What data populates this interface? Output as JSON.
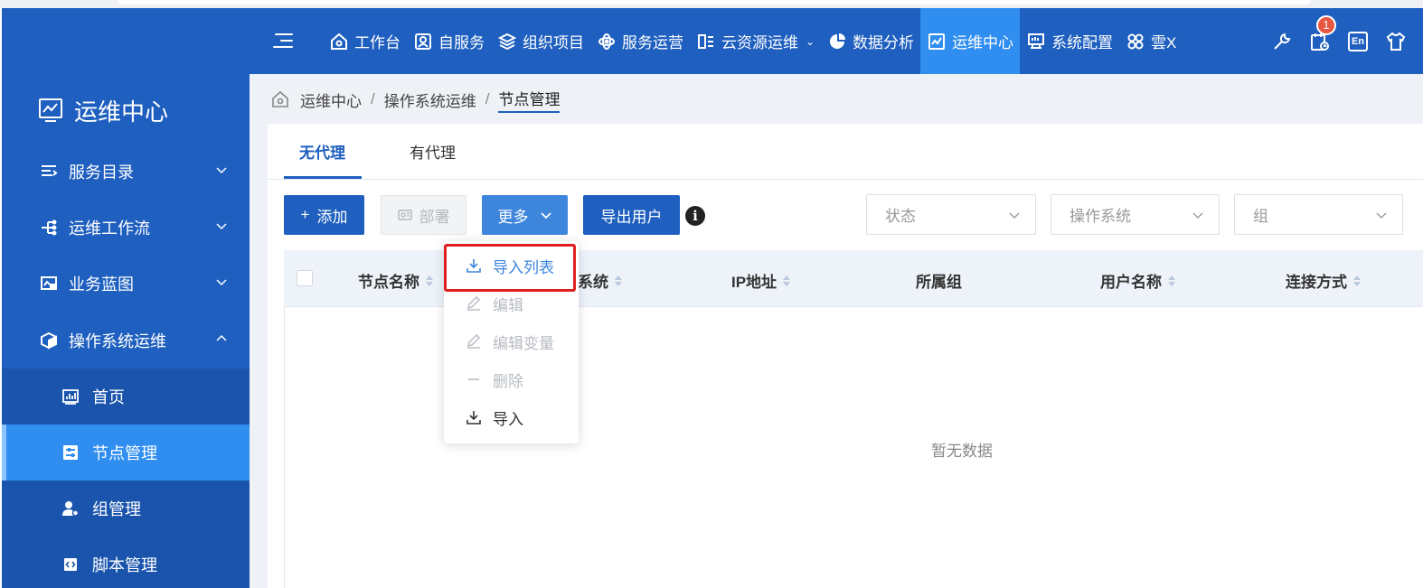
{
  "topnav": {
    "items": [
      {
        "label": "工作台",
        "icon": "home-icon"
      },
      {
        "label": "自服务",
        "icon": "user-card-icon"
      },
      {
        "label": "组织项目",
        "icon": "layers-icon"
      },
      {
        "label": "服务运营",
        "icon": "atom-icon"
      },
      {
        "label": "云资源运维",
        "icon": "id-card-icon",
        "has_caret": true
      },
      {
        "label": "数据分析",
        "icon": "pie-chart-icon"
      },
      {
        "label": "运维中心",
        "icon": "line-chart-icon",
        "active": true
      },
      {
        "label": "系统配置",
        "icon": "monitor-icon"
      },
      {
        "label": "雲X",
        "icon": "clover-icon"
      }
    ],
    "notification_count": "1",
    "lang_label": "En"
  },
  "sidebar": {
    "title": "运维中心",
    "groups": [
      {
        "label": "服务目录",
        "expanded": false
      },
      {
        "label": "运维工作流",
        "expanded": false
      },
      {
        "label": "业务蓝图",
        "expanded": false
      },
      {
        "label": "操作系统运维",
        "expanded": true
      }
    ],
    "subitems": [
      {
        "label": "首页"
      },
      {
        "label": "节点管理",
        "active": true
      },
      {
        "label": "组管理"
      },
      {
        "label": "脚本管理"
      }
    ]
  },
  "breadcrumb": [
    "运维中心",
    "操作系统运维",
    "节点管理"
  ],
  "tabs": [
    "无代理",
    "有代理"
  ],
  "toolbar": {
    "add_label": "添加",
    "deploy_label": "部署",
    "more_label": "更多",
    "export_label": "导出用户"
  },
  "filters": {
    "status_placeholder": "状态",
    "os_placeholder": "操作系统",
    "group_placeholder": "组"
  },
  "table": {
    "columns": [
      "节点名称",
      "系统",
      "IP地址",
      "所属组",
      "用户名称",
      "连接方式"
    ],
    "empty_text": "暂无数据"
  },
  "more_menu": {
    "items": [
      {
        "label": "导入列表",
        "state": "highlighted"
      },
      {
        "label": "编辑",
        "state": "disabled"
      },
      {
        "label": "编辑变量",
        "state": "disabled"
      },
      {
        "label": "删除",
        "state": "disabled"
      },
      {
        "label": "导入",
        "state": "normal"
      }
    ]
  },
  "colors": {
    "brand": "#1e5fbf",
    "active": "#2f8ef0",
    "badge": "#e8573f",
    "highlight_box": "#e02020"
  }
}
